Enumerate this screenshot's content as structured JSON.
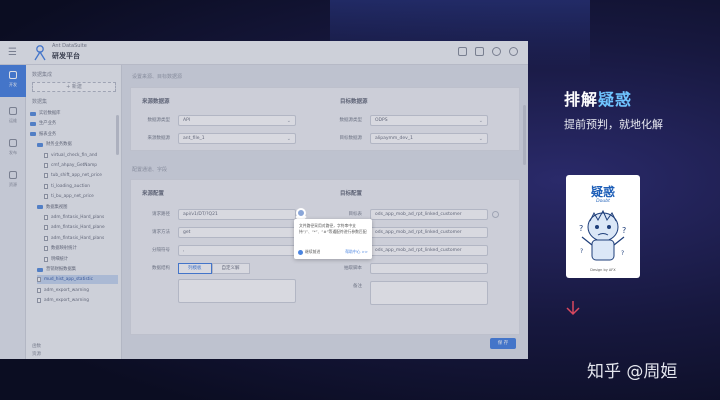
{
  "app": {
    "menu_icon": "menu-icon",
    "brand_small": "Ant DataSuite",
    "brand": "研发平台",
    "toolbar_icons": [
      "screen-icon",
      "grid-icon",
      "clock-icon",
      "avatar-icon"
    ]
  },
  "rail": [
    {
      "label": "开发",
      "icon": "code-icon",
      "active": true
    },
    {
      "label": "运维",
      "icon": "chart-icon",
      "active": false
    },
    {
      "label": "发布",
      "icon": "send-icon",
      "active": false
    },
    {
      "label": "资源",
      "icon": "database-icon",
      "active": false
    }
  ],
  "tree": {
    "header": "数据集成",
    "add_label": "+ 新建",
    "section": "数据集",
    "items": [
      {
        "label": "实验数据库",
        "type": "folder",
        "depth": 0
      },
      {
        "label": "生产业务",
        "type": "folder",
        "depth": 0
      },
      {
        "label": "报表业务",
        "type": "folder",
        "depth": 0
      },
      {
        "label": "财务业务数据",
        "type": "folder",
        "depth": 1
      },
      {
        "label": "virtual_check_fin_and",
        "type": "file",
        "depth": 2
      },
      {
        "label": "cmf_ahpay_GetNamp",
        "type": "file",
        "depth": 2
      },
      {
        "label": "tub_shift_app_net_price",
        "type": "file",
        "depth": 2
      },
      {
        "label": "ti_loading_auction",
        "type": "file",
        "depth": 2
      },
      {
        "label": "ti_bu_app_net_price",
        "type": "file",
        "depth": 2
      },
      {
        "label": "数据集视图",
        "type": "folder",
        "depth": 1
      },
      {
        "label": "adm_fintasis_Hard_plans",
        "type": "file",
        "depth": 2
      },
      {
        "label": "adm_fintasis_Hard_plane",
        "type": "file",
        "depth": 2
      },
      {
        "label": "adm_fintasis_Hard_plans",
        "type": "file",
        "depth": 2
      },
      {
        "label": "数据映射统计",
        "type": "file",
        "depth": 2
      },
      {
        "label": "明细统计",
        "type": "file",
        "depth": 2
      },
      {
        "label": "营销财报数据集",
        "type": "folder",
        "depth": 1
      },
      {
        "label": "mud_hist_app_statistic",
        "type": "file",
        "depth": 1,
        "selected": true
      },
      {
        "label": "adm_export_warning",
        "type": "file",
        "depth": 1
      },
      {
        "label": "adm_export_warning",
        "type": "file",
        "depth": 1
      }
    ],
    "footer": [
      "函数",
      "资源"
    ]
  },
  "main": {
    "breadcrumb": "设置来源、目标数据源",
    "source_title": "来源数据源",
    "target_title": "目标数据源",
    "source_fields": [
      {
        "label": "数据源类型",
        "value": "API"
      },
      {
        "label": "来源数据源",
        "value": "ant_file_1"
      }
    ],
    "target_fields": [
      {
        "label": "数据源类型",
        "value": "ODPS"
      },
      {
        "label": "目标数据源",
        "value": "alipaymm_dev_1"
      }
    ],
    "breadcrumb2": "配置通道、字段",
    "source_cfg_title": "来源配置",
    "target_cfg_title": "目标配置",
    "source_cfg": [
      {
        "label": "请求路径",
        "value": "api/v1/DT/?Q21"
      },
      {
        "label": "请求方法",
        "value": "get"
      },
      {
        "label": "分隔符号",
        "value": ","
      }
    ],
    "target_cfg": [
      {
        "label": "目标表",
        "value": "ods_app_mob_ad_rpt_linked_customer"
      },
      {
        "label": "分区表",
        "value": "ods_app_mob_ad_rpt_linked_customer"
      },
      {
        "label": "分区字段",
        "value": "ods_app_mob_ad_rpt_linked_customer"
      }
    ],
    "request_label": "数据结构",
    "segment": [
      "列模板",
      "自定义解"
    ],
    "sql_label": "抽取脚本",
    "remark_label": "备注",
    "confirm_label": "保 存"
  },
  "tooltip": {
    "text": "文件路径采用对路径，字符串中支持“/”、“*”、“#”等通配符进行参数匹配",
    "option": "继续前进",
    "link": "帮助中心 >>"
  },
  "right": {
    "heading_a": "排解",
    "heading_b": "疑惑",
    "subheading": "提前预判，就地化解",
    "card_title": "疑惑",
    "card_sub": "Doubt",
    "card_caption": "Design by AFX"
  },
  "watermark": "知乎 @周姮",
  "colors": {
    "accent": "#4a84e0",
    "highlight": "#6fc4ff",
    "background": "#0b0d22"
  }
}
